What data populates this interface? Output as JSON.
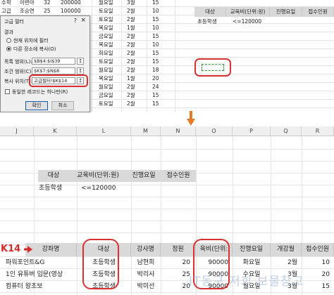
{
  "top": {
    "rows": [
      {
        "a": "수학",
        "b": "이번야",
        "c": "32",
        "d": "200000",
        "e": "월요일",
        "f": "3월",
        "g": "15"
      },
      {
        "a": "고급",
        "b": "조승연",
        "c": "25",
        "d": "100000",
        "e": "토요일",
        "f": "2월",
        "g": "10"
      },
      {
        "a": "",
        "b": "",
        "c": "",
        "d": "",
        "e": "토요일",
        "f": "2월",
        "g": "15"
      },
      {
        "a": "",
        "b": "",
        "c": "",
        "d": "",
        "e": "목요일",
        "f": "1월",
        "g": "10"
      },
      {
        "a": "",
        "b": "",
        "c": "",
        "d": "",
        "e": "금요일",
        "f": "2월",
        "g": "15"
      },
      {
        "a": "",
        "b": "",
        "c": "",
        "d": "",
        "e": "목요일",
        "f": "2월",
        "g": "10"
      },
      {
        "a": "",
        "b": "",
        "c": "",
        "d": "",
        "e": "화요일",
        "f": "2월",
        "g": "15"
      },
      {
        "a": "",
        "b": "",
        "c": "",
        "d": "",
        "e": "토요일",
        "f": "2월",
        "g": "15"
      },
      {
        "a": "",
        "b": "",
        "c": "",
        "d": "",
        "e": "월요일",
        "f": "2월",
        "g": "18"
      },
      {
        "a": "",
        "b": "",
        "c": "",
        "d": "",
        "e": "목요일",
        "f": "1월",
        "g": "20"
      },
      {
        "a": "",
        "b": "",
        "c": "",
        "d": "",
        "e": "월요일",
        "f": "2월",
        "g": "24"
      },
      {
        "a": "",
        "b": "",
        "c": "",
        "d": "",
        "e": "금요일",
        "f": "2월",
        "g": "15"
      },
      {
        "a": "",
        "b": "",
        "c": "",
        "d": "",
        "e": "토요일",
        "f": "2월",
        "g": "15"
      }
    ],
    "criteria": {
      "headers": [
        "대상",
        "교육비(단위:원)",
        "진행요일",
        "접수인원"
      ],
      "values": [
        "초등학생",
        "<=120000",
        "",
        ""
      ]
    }
  },
  "dialog": {
    "title": "고급 필터",
    "help": "?",
    "close": "×",
    "result_label": "결과",
    "radio_inplace": "현재 위치에 필터",
    "radio_copy": "다른 장소에 복사(O)",
    "list_range_label": "목록 범위(L):",
    "list_range_value": "$B$4:$I$39",
    "criteria_range_label": "조건 범위(C):",
    "criteria_range_value": "$K$7:$N$8",
    "copy_to_label": "복사 위치(T):",
    "copy_to_value": "고급필터!$K$14",
    "unique_label": "동일한 레코드는 하나만(R)",
    "ok": "확인",
    "cancel": "취소",
    "range_btn": "↥"
  },
  "bottom": {
    "columns": [
      "J",
      "K",
      "L",
      "M",
      "N",
      "O",
      "P",
      "Q",
      "R"
    ],
    "criteria": {
      "headers": [
        "대상",
        "교육비(단위:원)",
        "진행요일",
        "접수인원"
      ],
      "values": [
        "초등학생",
        "<=120000",
        "",
        ""
      ]
    },
    "cell_ref": "K14",
    "table_headers": [
      "강좌명",
      "대상",
      "강사명",
      "정원",
      "육비(단위:",
      "진행요일",
      "개강월",
      "접수인원"
    ],
    "rows": [
      {
        "name": "파워포인트&G",
        "target": "초등학생",
        "teacher": "남현희",
        "cap": "20",
        "fee": "90000",
        "day": "화요일",
        "month": "2월",
        "count": "10"
      },
      {
        "name": "1인 유튜버 입문(영상",
        "target": "초등학생",
        "teacher": "박리사",
        "cap": "25",
        "fee": "90000",
        "day": "수요일",
        "month": "3월",
        "count": "20"
      },
      {
        "name": "컴퓨터 왕초보",
        "target": "초등학생",
        "teacher": "박미선",
        "cap": "20",
        "fee": "90000",
        "day": "월요일",
        "month": "3월",
        "count": "15"
      }
    ],
    "watermark": "IT동구 저희 보물창고"
  },
  "colors": {
    "accent_red": "#d93030",
    "header_gray": "#d9d9d9",
    "arrow_orange": "#e87b26"
  }
}
